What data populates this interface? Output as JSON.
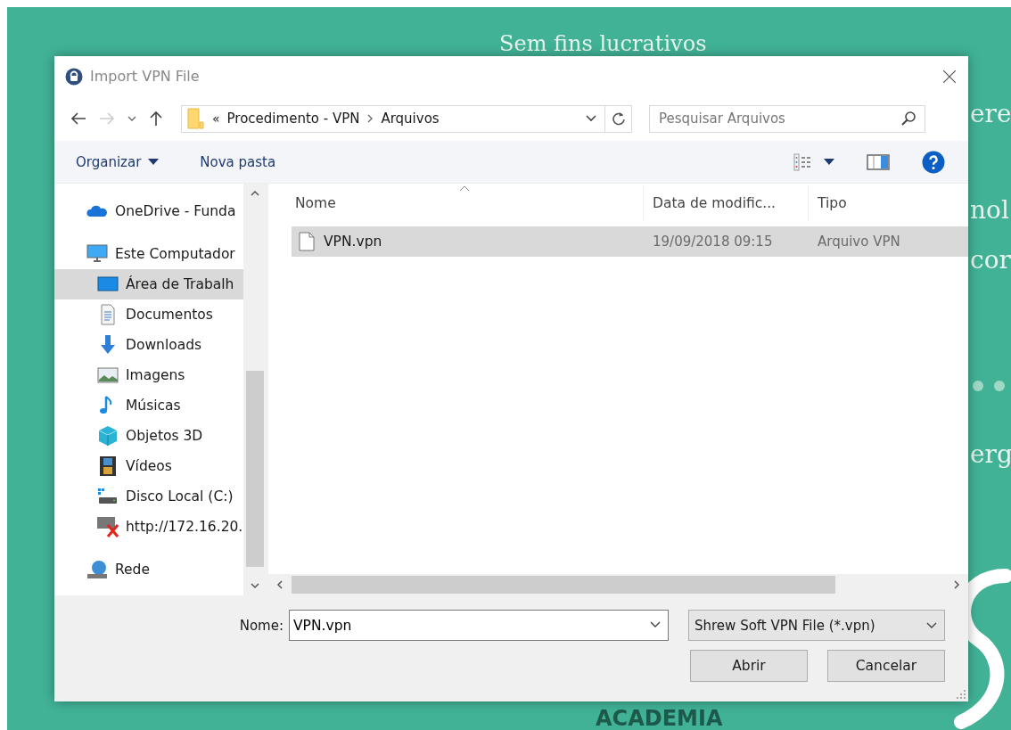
{
  "background": {
    "heading": "Sem fins lucrativos",
    "fragments": [
      {
        "text": "ere"
      },
      {
        "text": "nol"
      },
      {
        "text": "cor"
      },
      {
        "text": "erg"
      }
    ],
    "footer": "ACADEMIA"
  },
  "dialog": {
    "title": "Import VPN File",
    "breadcrumb": {
      "overflow": "«",
      "parts": [
        "Procedimento - VPN",
        "Arquivos"
      ]
    },
    "search": {
      "placeholder": "Pesquisar Arquivos"
    },
    "toolbar": {
      "organize": "Organizar",
      "new_folder": "Nova pasta"
    },
    "sidebar": {
      "items": [
        {
          "label": "OneDrive - Funda",
          "kind": "cloud",
          "selected": false
        },
        {
          "label": "Este Computador",
          "kind": "computer",
          "selected": false,
          "children": [
            {
              "label": "Área de Trabalh",
              "kind": "desktop",
              "selected": true
            },
            {
              "label": "Documentos",
              "kind": "document",
              "selected": false
            },
            {
              "label": "Downloads",
              "kind": "download",
              "selected": false
            },
            {
              "label": "Imagens",
              "kind": "picture",
              "selected": false
            },
            {
              "label": "Músicas",
              "kind": "music",
              "selected": false
            },
            {
              "label": "Objetos 3D",
              "kind": "cube",
              "selected": false
            },
            {
              "label": "Vídeos",
              "kind": "film",
              "selected": false
            },
            {
              "label": "Disco Local (C:)",
              "kind": "drive",
              "selected": false
            },
            {
              "label": "http://172.16.20.",
              "kind": "netdrive",
              "selected": false
            }
          ]
        },
        {
          "label": "Rede",
          "kind": "network",
          "selected": false
        }
      ]
    },
    "table": {
      "columns": [
        "Nome",
        "Data de modific...",
        "Tipo"
      ],
      "rows": [
        {
          "name": "VPN.vpn",
          "date": "19/09/2018 09:15",
          "type": "Arquivo VPN",
          "selected": true
        }
      ]
    },
    "filename": {
      "label": "Nome:",
      "value": "VPN.vpn"
    },
    "filter": "Shrew Soft VPN File (*.vpn)",
    "buttons": [
      "Abrir",
      "Cancelar"
    ]
  }
}
